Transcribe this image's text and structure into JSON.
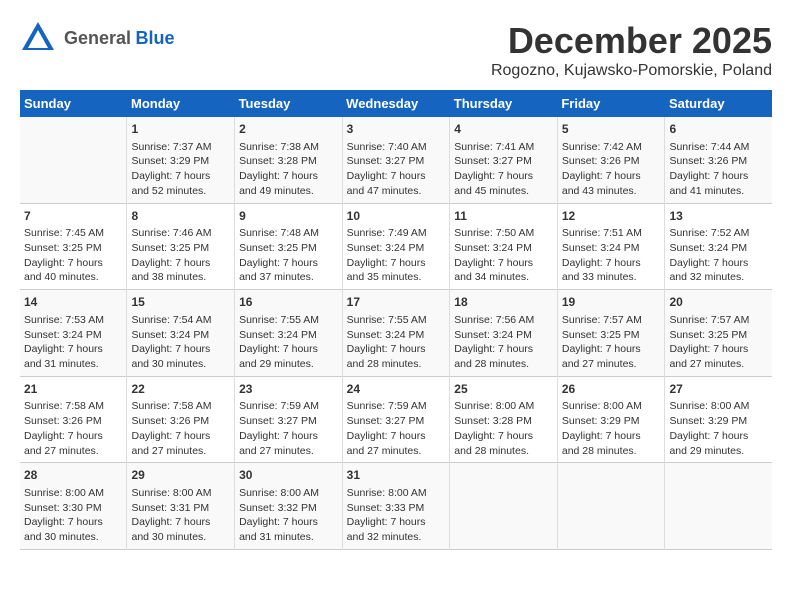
{
  "logo": {
    "general": "General",
    "blue": "Blue"
  },
  "title": "December 2025",
  "subtitle": "Rogozno, Kujawsko-Pomorskie, Poland",
  "weekdays": [
    "Sunday",
    "Monday",
    "Tuesday",
    "Wednesday",
    "Thursday",
    "Friday",
    "Saturday"
  ],
  "weeks": [
    [
      {
        "day": "",
        "info": ""
      },
      {
        "day": "1",
        "info": "Sunrise: 7:37 AM\nSunset: 3:29 PM\nDaylight: 7 hours\nand 52 minutes."
      },
      {
        "day": "2",
        "info": "Sunrise: 7:38 AM\nSunset: 3:28 PM\nDaylight: 7 hours\nand 49 minutes."
      },
      {
        "day": "3",
        "info": "Sunrise: 7:40 AM\nSunset: 3:27 PM\nDaylight: 7 hours\nand 47 minutes."
      },
      {
        "day": "4",
        "info": "Sunrise: 7:41 AM\nSunset: 3:27 PM\nDaylight: 7 hours\nand 45 minutes."
      },
      {
        "day": "5",
        "info": "Sunrise: 7:42 AM\nSunset: 3:26 PM\nDaylight: 7 hours\nand 43 minutes."
      },
      {
        "day": "6",
        "info": "Sunrise: 7:44 AM\nSunset: 3:26 PM\nDaylight: 7 hours\nand 41 minutes."
      }
    ],
    [
      {
        "day": "7",
        "info": "Sunrise: 7:45 AM\nSunset: 3:25 PM\nDaylight: 7 hours\nand 40 minutes."
      },
      {
        "day": "8",
        "info": "Sunrise: 7:46 AM\nSunset: 3:25 PM\nDaylight: 7 hours\nand 38 minutes."
      },
      {
        "day": "9",
        "info": "Sunrise: 7:48 AM\nSunset: 3:25 PM\nDaylight: 7 hours\nand 37 minutes."
      },
      {
        "day": "10",
        "info": "Sunrise: 7:49 AM\nSunset: 3:24 PM\nDaylight: 7 hours\nand 35 minutes."
      },
      {
        "day": "11",
        "info": "Sunrise: 7:50 AM\nSunset: 3:24 PM\nDaylight: 7 hours\nand 34 minutes."
      },
      {
        "day": "12",
        "info": "Sunrise: 7:51 AM\nSunset: 3:24 PM\nDaylight: 7 hours\nand 33 minutes."
      },
      {
        "day": "13",
        "info": "Sunrise: 7:52 AM\nSunset: 3:24 PM\nDaylight: 7 hours\nand 32 minutes."
      }
    ],
    [
      {
        "day": "14",
        "info": "Sunrise: 7:53 AM\nSunset: 3:24 PM\nDaylight: 7 hours\nand 31 minutes."
      },
      {
        "day": "15",
        "info": "Sunrise: 7:54 AM\nSunset: 3:24 PM\nDaylight: 7 hours\nand 30 minutes."
      },
      {
        "day": "16",
        "info": "Sunrise: 7:55 AM\nSunset: 3:24 PM\nDaylight: 7 hours\nand 29 minutes."
      },
      {
        "day": "17",
        "info": "Sunrise: 7:55 AM\nSunset: 3:24 PM\nDaylight: 7 hours\nand 28 minutes."
      },
      {
        "day": "18",
        "info": "Sunrise: 7:56 AM\nSunset: 3:24 PM\nDaylight: 7 hours\nand 28 minutes."
      },
      {
        "day": "19",
        "info": "Sunrise: 7:57 AM\nSunset: 3:25 PM\nDaylight: 7 hours\nand 27 minutes."
      },
      {
        "day": "20",
        "info": "Sunrise: 7:57 AM\nSunset: 3:25 PM\nDaylight: 7 hours\nand 27 minutes."
      }
    ],
    [
      {
        "day": "21",
        "info": "Sunrise: 7:58 AM\nSunset: 3:26 PM\nDaylight: 7 hours\nand 27 minutes."
      },
      {
        "day": "22",
        "info": "Sunrise: 7:58 AM\nSunset: 3:26 PM\nDaylight: 7 hours\nand 27 minutes."
      },
      {
        "day": "23",
        "info": "Sunrise: 7:59 AM\nSunset: 3:27 PM\nDaylight: 7 hours\nand 27 minutes."
      },
      {
        "day": "24",
        "info": "Sunrise: 7:59 AM\nSunset: 3:27 PM\nDaylight: 7 hours\nand 27 minutes."
      },
      {
        "day": "25",
        "info": "Sunrise: 8:00 AM\nSunset: 3:28 PM\nDaylight: 7 hours\nand 28 minutes."
      },
      {
        "day": "26",
        "info": "Sunrise: 8:00 AM\nSunset: 3:29 PM\nDaylight: 7 hours\nand 28 minutes."
      },
      {
        "day": "27",
        "info": "Sunrise: 8:00 AM\nSunset: 3:29 PM\nDaylight: 7 hours\nand 29 minutes."
      }
    ],
    [
      {
        "day": "28",
        "info": "Sunrise: 8:00 AM\nSunset: 3:30 PM\nDaylight: 7 hours\nand 30 minutes."
      },
      {
        "day": "29",
        "info": "Sunrise: 8:00 AM\nSunset: 3:31 PM\nDaylight: 7 hours\nand 30 minutes."
      },
      {
        "day": "30",
        "info": "Sunrise: 8:00 AM\nSunset: 3:32 PM\nDaylight: 7 hours\nand 31 minutes."
      },
      {
        "day": "31",
        "info": "Sunrise: 8:00 AM\nSunset: 3:33 PM\nDaylight: 7 hours\nand 32 minutes."
      },
      {
        "day": "",
        "info": ""
      },
      {
        "day": "",
        "info": ""
      },
      {
        "day": "",
        "info": ""
      }
    ]
  ]
}
